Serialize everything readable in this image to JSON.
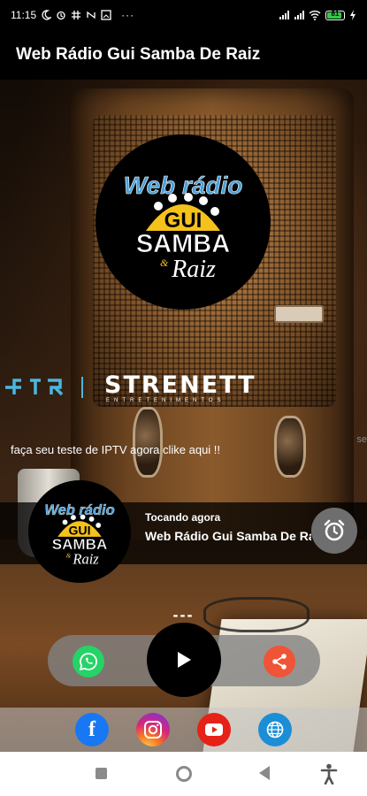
{
  "status_bar": {
    "time": "11:15",
    "icons": [
      "moon-icon",
      "alarm-icon",
      "hashtag-icon",
      "nfc-icon",
      "gallery-icon",
      "more-dots-icon"
    ],
    "right_icons": [
      "signal-icon",
      "signal-icon",
      "wifi-icon",
      "battery-icon",
      "charging-icon"
    ],
    "battery_level": 0.81,
    "battery_text": "81"
  },
  "app_bar": {
    "title": "Web Rádio Gui Samba De Raiz"
  },
  "logo": {
    "line1": "Web rádio",
    "line2": "GUI",
    "line3": "SAMBA",
    "line4": "Raiz",
    "amp": "&"
  },
  "sponsor_banner": {
    "brand": "STRENETT",
    "subtitle": "ENTRETENIMENTOS"
  },
  "ticker": {
    "text": "faça seu teste de IPTV agora clike aqui !!",
    "overflow": "se"
  },
  "player": {
    "now_playing_label": "Tocando agora",
    "now_playing_title": "Web Rádio Gui Samba De Raiz",
    "time_display": "---"
  },
  "controls": {
    "whatsapp_icon": "whatsapp-icon",
    "play_icon": "play-icon",
    "share_icon": "share-icon",
    "alarm_icon": "alarm-clock-icon"
  },
  "social": [
    {
      "name": "facebook-icon",
      "glyph": "f"
    },
    {
      "name": "instagram-icon"
    },
    {
      "name": "youtube-icon"
    },
    {
      "name": "website-icon"
    }
  ],
  "colors": {
    "whatsapp": "#25d366",
    "share": "#ef5436",
    "facebook": "#1877f2",
    "youtube": "#e62117",
    "website": "#1c8ed6",
    "logo_yellow": "#f4c21a",
    "logo_blue": "#4a9fd8"
  }
}
